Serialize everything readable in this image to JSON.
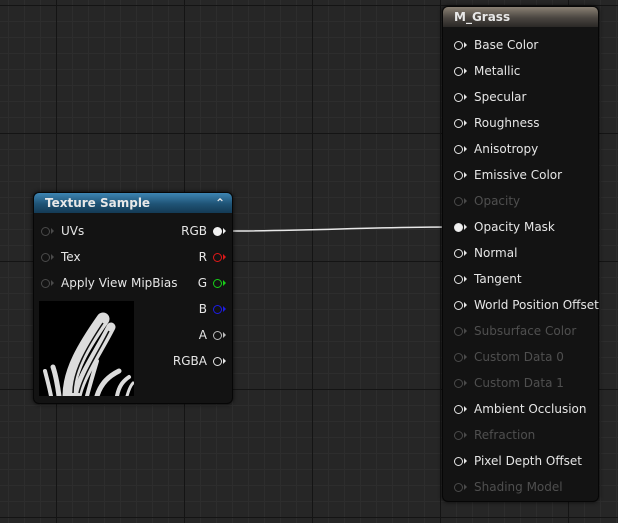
{
  "material_node": {
    "title": "M_Grass",
    "inputs": [
      {
        "label": "Base Color",
        "enabled": true,
        "connected": false
      },
      {
        "label": "Metallic",
        "enabled": true,
        "connected": false
      },
      {
        "label": "Specular",
        "enabled": true,
        "connected": false
      },
      {
        "label": "Roughness",
        "enabled": true,
        "connected": false
      },
      {
        "label": "Anisotropy",
        "enabled": true,
        "connected": false
      },
      {
        "label": "Emissive Color",
        "enabled": true,
        "connected": false
      },
      {
        "label": "Opacity",
        "enabled": false,
        "connected": false
      },
      {
        "label": "Opacity Mask",
        "enabled": true,
        "connected": true
      },
      {
        "label": "Normal",
        "enabled": true,
        "connected": false
      },
      {
        "label": "Tangent",
        "enabled": true,
        "connected": false
      },
      {
        "label": "World Position Offset",
        "enabled": true,
        "connected": false
      },
      {
        "label": "Subsurface Color",
        "enabled": false,
        "connected": false
      },
      {
        "label": "Custom Data 0",
        "enabled": false,
        "connected": false
      },
      {
        "label": "Custom Data 1",
        "enabled": false,
        "connected": false
      },
      {
        "label": "Ambient Occlusion",
        "enabled": true,
        "connected": false
      },
      {
        "label": "Refraction",
        "enabled": false,
        "connected": false
      },
      {
        "label": "Pixel Depth Offset",
        "enabled": true,
        "connected": false
      },
      {
        "label": "Shading Model",
        "enabled": false,
        "connected": false
      }
    ]
  },
  "texture_node": {
    "title": "Texture Sample",
    "collapse_glyph": "⌃",
    "inputs": [
      {
        "label": "UVs"
      },
      {
        "label": "Tex"
      },
      {
        "label": "Apply View MipBias"
      }
    ],
    "outputs": [
      {
        "label": "RGB",
        "color": "#f0f0f0",
        "connected": true
      },
      {
        "label": "R",
        "color": "#e01818",
        "connected": false
      },
      {
        "label": "G",
        "color": "#18d018",
        "connected": false
      },
      {
        "label": "B",
        "color": "#1c1ce8",
        "connected": false
      },
      {
        "label": "A",
        "color": "#bdbdbd",
        "connected": false
      },
      {
        "label": "RGBA",
        "color": "#e6e6e6",
        "connected": false
      }
    ]
  },
  "wires": [
    {
      "from": "texture_node.outputs.RGB",
      "to": "material_node.inputs.Opacity Mask",
      "color": "#e8e8e8"
    }
  ]
}
